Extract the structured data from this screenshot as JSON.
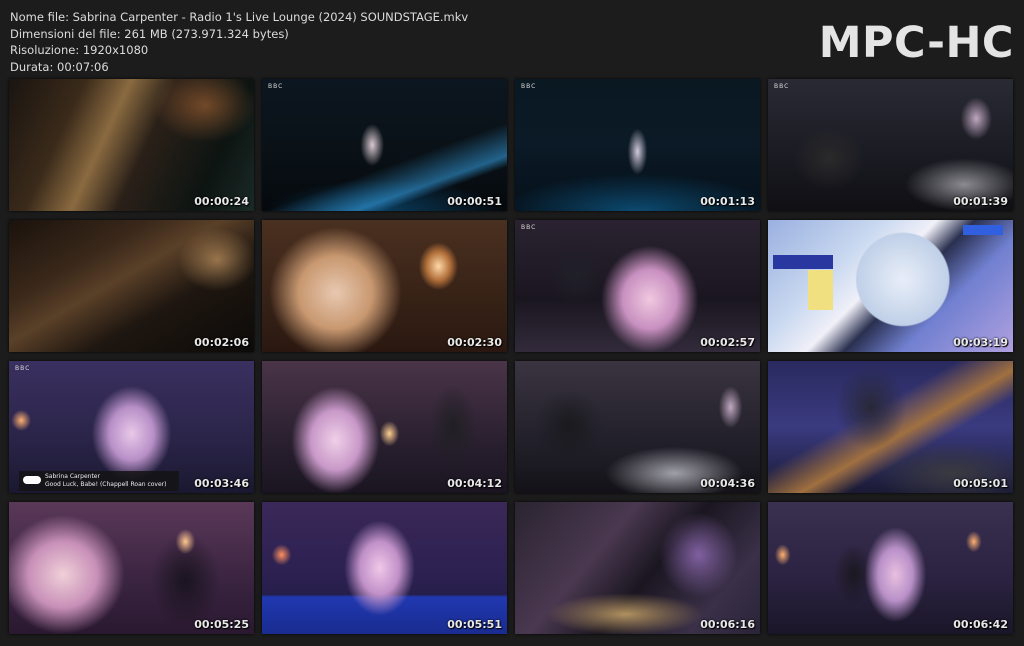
{
  "info": {
    "filename": "Nome file: Sabrina Carpenter - Radio 1's Live Lounge (2024) SOUNDSTAGE.mkv",
    "filesize": "Dimensioni del file: 261 MB (273.971.324 bytes)",
    "resolution": "Risoluzione: 1920x1080",
    "duration": "Durata: 00:07:06"
  },
  "logo": "MPC-HC",
  "watermark": "BBC",
  "caption": {
    "line1": "Sabrina Carpenter",
    "line2": "Good Luck, Babe! (Chappell Roan cover)"
  },
  "thumbnails": [
    {
      "time": "00:00:24",
      "scene": "guitar-closeup"
    },
    {
      "time": "00:00:51",
      "scene": "stage-wide"
    },
    {
      "time": "00:01:13",
      "scene": "stage-wide-blue"
    },
    {
      "time": "00:01:39",
      "scene": "drummer"
    },
    {
      "time": "00:02:06",
      "scene": "bass-closeup"
    },
    {
      "time": "00:02:30",
      "scene": "singer-closeup"
    },
    {
      "time": "00:02:57",
      "scene": "singer-keys"
    },
    {
      "time": "00:03:19",
      "scene": "graphic-transition"
    },
    {
      "time": "00:03:46",
      "scene": "singer-caption"
    },
    {
      "time": "00:04:12",
      "scene": "singer-backing"
    },
    {
      "time": "00:04:36",
      "scene": "drummer-2"
    },
    {
      "time": "00:05:01",
      "scene": "guitarist-blue"
    },
    {
      "time": "00:05:25",
      "scene": "singer-mic"
    },
    {
      "time": "00:05:51",
      "scene": "singer-stand"
    },
    {
      "time": "00:06:16",
      "scene": "cymbal-blur"
    },
    {
      "time": "00:06:42",
      "scene": "band-wide"
    }
  ]
}
